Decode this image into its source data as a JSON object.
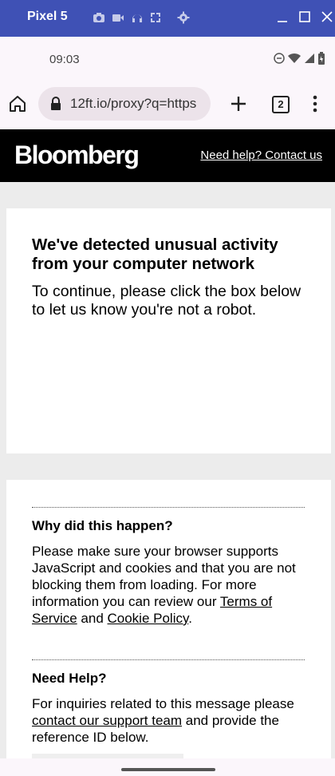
{
  "emulator": {
    "title": "Pixel 5"
  },
  "status": {
    "time": "09:03"
  },
  "browser": {
    "url": "12ft.io/proxy?q=https",
    "tab_count": "2"
  },
  "header": {
    "logo": "Bloomberg",
    "help_link": "Need help? Contact us"
  },
  "notice": {
    "heading": "We've detected unusual activity from your computer network",
    "body": "To continue, please click the box below to let us know you're not a robot."
  },
  "why": {
    "heading": "Why did this happen?",
    "body_1": "Please make sure your browser supports JavaScript and cookies and that you are not blocking them from loading. For more information you can review our ",
    "terms_link": "Terms of Service",
    "and": " and ",
    "cookie_link": "Cookie Policy",
    "period": "."
  },
  "help": {
    "heading": "Need Help?",
    "body_1": "For inquiries related to this message please ",
    "support_link": "contact our support team",
    "body_2": " and provide the reference ID below."
  }
}
